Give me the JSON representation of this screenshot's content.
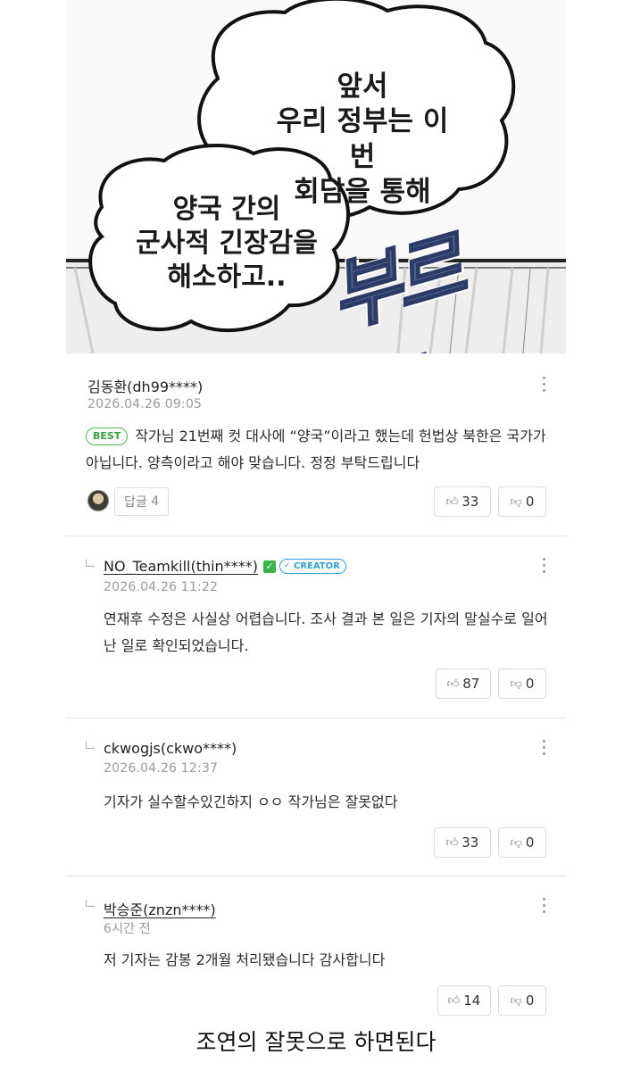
{
  "comic": {
    "bubble_1": [
      "앞서",
      "우리 정부는 이번",
      "회담을 통해"
    ],
    "bubble_2": [
      "양국 간의",
      "군사적 긴장감을",
      "해소하고.."
    ],
    "sfx": "부르릉.."
  },
  "comments": [
    {
      "author": "김동환(dh99****)",
      "date": "2026.04.26 09:05",
      "badge": "BEST",
      "body": "작가님 21번째 컷 대사에 “양국”이라고 했는데 헌법상 북한은 국가가 아닙니다. 양측이라고 해야 맞습니다. 정정 부탁드립니다",
      "reply_label": "답글",
      "reply_count": "4",
      "likes": "33",
      "dislikes": "0"
    },
    {
      "author": "NO_Teamkill(thin****)",
      "creator_badge": "CREATOR",
      "date": "2026.04.26 11:22",
      "body": "연재후 수정은 사실상 어렵습니다. 조사 결과 본 일은 기자의 말실수로 일어난 일로 확인되었습니다.",
      "likes": "87",
      "dislikes": "0"
    },
    {
      "author": "ckwogjs(ckwo****)",
      "date": "2026.04.26 12:37",
      "body": "기자가 실수할수있긴하지 ㅇㅇ 작가님은 잘못없다",
      "likes": "33",
      "dislikes": "0"
    },
    {
      "author": "박승준(znzn****)",
      "date": "6시간 전",
      "body": "저 기자는 감봉 2개월 처리됐습니다 감사합니다",
      "likes": "14",
      "dislikes": "0"
    }
  ],
  "caption": "조연의 잘못으로 하면된다",
  "icons": {
    "like": "thumbs-up-icon",
    "dislike": "thumbs-down-icon",
    "more": "more-vertical-icon",
    "reply_arrow": "reply-arrow-icon"
  }
}
